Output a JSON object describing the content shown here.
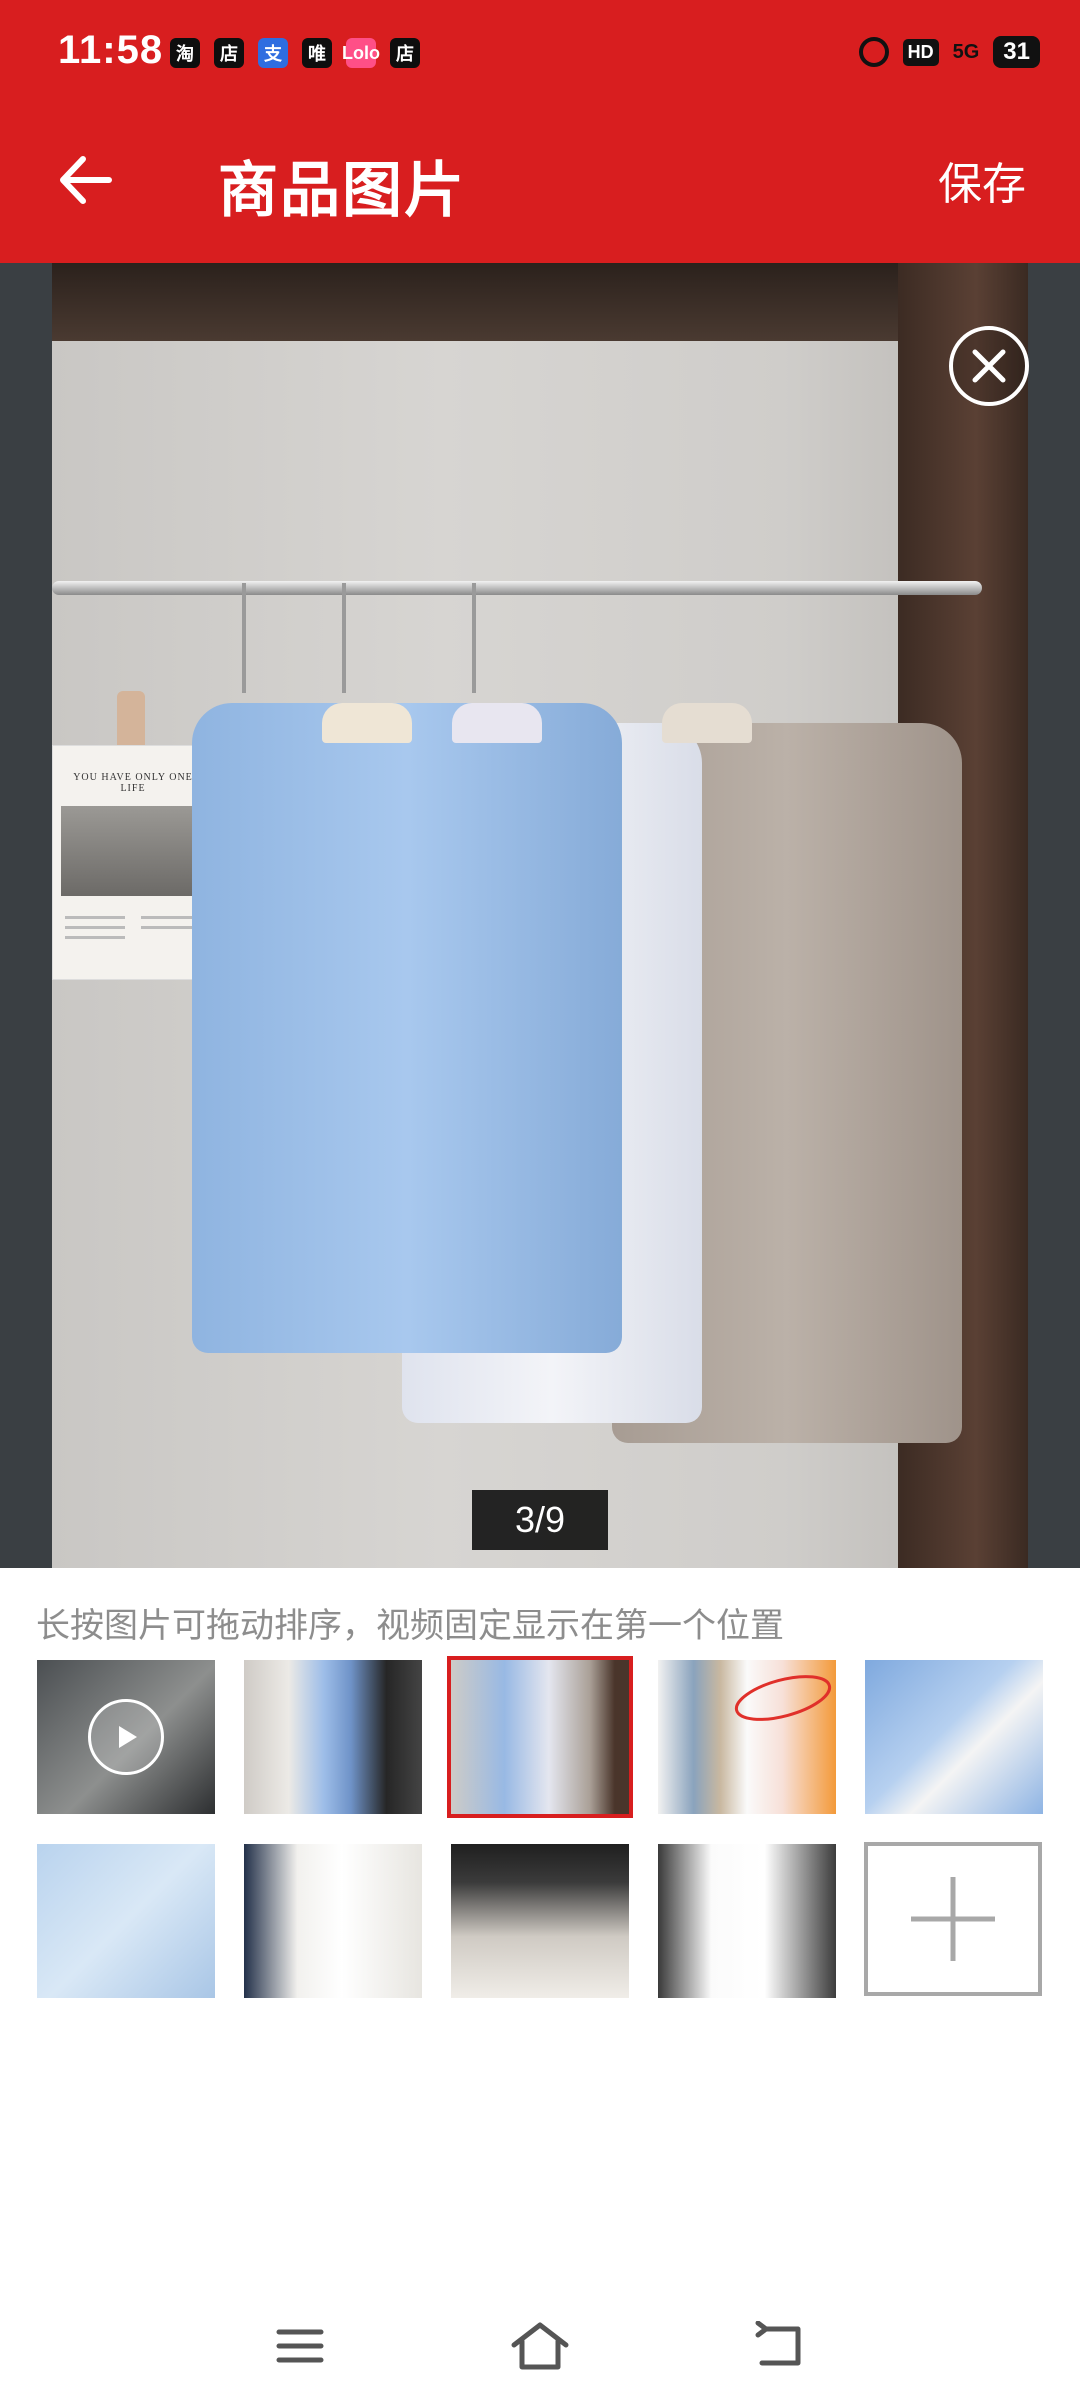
{
  "status_bar": {
    "time": "11:58",
    "app_icons": [
      "淘",
      "店",
      "支",
      "唯",
      "Lolo",
      "店"
    ],
    "hd": "HD",
    "network": "5G",
    "battery": "31"
  },
  "header": {
    "title": "商品图片",
    "save_label": "保存",
    "accent_color": "#d81e1f"
  },
  "viewer": {
    "counter": "3/9",
    "poster_text": "YOU HAVE ONLY ONE LIFE"
  },
  "gallery": {
    "hint": "长按图片可拖动排序，视频固定显示在第一个位置",
    "thumbnails": [
      {
        "kind": "video",
        "selected": false
      },
      {
        "kind": "image",
        "selected": false
      },
      {
        "kind": "image",
        "selected": true
      },
      {
        "kind": "image",
        "selected": false
      },
      {
        "kind": "image",
        "selected": false
      },
      {
        "kind": "image",
        "selected": false
      },
      {
        "kind": "image",
        "selected": false
      },
      {
        "kind": "image",
        "selected": false
      },
      {
        "kind": "image",
        "selected": false
      }
    ],
    "add_icon": "plus-icon"
  },
  "navigation": {
    "items": [
      "menu-icon",
      "home-icon",
      "back-icon"
    ]
  }
}
